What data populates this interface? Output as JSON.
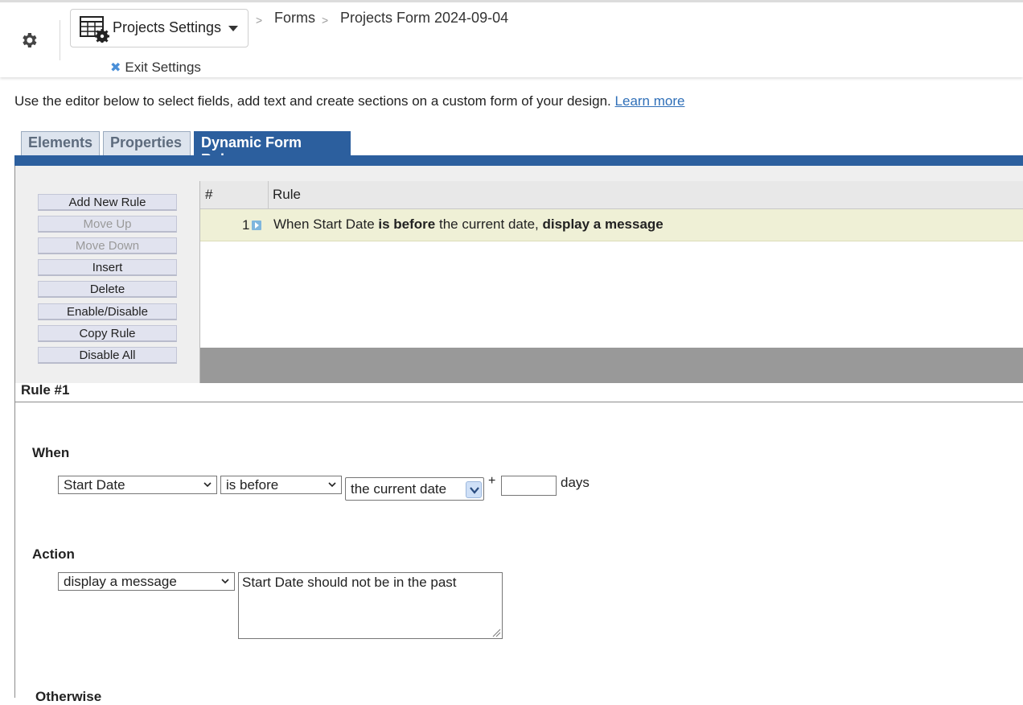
{
  "header": {
    "project_button_label": "Projects Settings",
    "breadcrumb": [
      "Forms",
      "Projects Form 2024-09-04"
    ],
    "exit_label": "Exit Settings"
  },
  "intro": {
    "text": "Use the editor below to select fields, add text and create sections on a custom form of your design.",
    "link": "Learn more"
  },
  "tabs": [
    {
      "label": "Elements",
      "active": false
    },
    {
      "label": "Properties",
      "active": false
    },
    {
      "label": "Dynamic Form Rules",
      "active": true
    }
  ],
  "rule_buttons": [
    {
      "label": "Add New Rule",
      "enabled": true
    },
    {
      "label": "Move Up",
      "enabled": false
    },
    {
      "label": "Move Down",
      "enabled": false
    },
    {
      "label": "Insert",
      "enabled": true
    },
    {
      "label": "Delete",
      "enabled": true
    },
    {
      "label": "Enable/Disable",
      "enabled": true
    },
    {
      "label": "Copy Rule",
      "enabled": true
    },
    {
      "label": "Disable All",
      "enabled": true
    }
  ],
  "rules_table": {
    "col_num": "#",
    "col_rule": "Rule",
    "rows": [
      {
        "num": "1",
        "parts": [
          "When Start Date ",
          "is before",
          " the current date, ",
          "display a message"
        ]
      }
    ]
  },
  "rule_detail": {
    "title": "Rule #1",
    "when_label": "When",
    "field_select": "Start Date",
    "operator_select": "is before",
    "date_select": "the current date",
    "plus": "+",
    "days_value": "",
    "days_label": "days",
    "action_label": "Action",
    "action_select": "display a message",
    "message_text": "Start Date should not be in the past",
    "otherwise_label": "Otherwise"
  },
  "colors": {
    "accent_blue": "#2c5f9e",
    "row_highlight": "#eff0d6",
    "link": "#2f6fb8"
  }
}
